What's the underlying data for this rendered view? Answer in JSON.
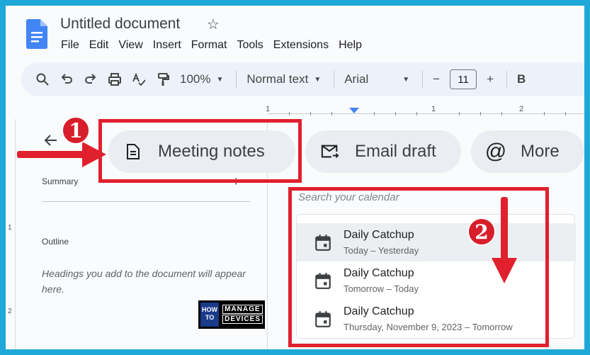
{
  "document": {
    "title": "Untitled document"
  },
  "menu": [
    "File",
    "Edit",
    "View",
    "Insert",
    "Format",
    "Tools",
    "Extensions",
    "Help"
  ],
  "toolbar": {
    "zoom": "100%",
    "style": "Normal text",
    "font": "Arial",
    "font_size": "11",
    "minus": "−",
    "plus": "+",
    "bold": "B"
  },
  "ruler": {
    "labels": [
      "1",
      "1",
      "2"
    ]
  },
  "vruler": {
    "labels": [
      "1",
      "2"
    ]
  },
  "outline": {
    "summary_label": "Summary",
    "add_symbol": "+",
    "outline_label": "Outline",
    "hint": "Headings you add to the document will appear here."
  },
  "chips": {
    "meeting_notes": "Meeting notes",
    "email_draft": "Email draft",
    "more": "More"
  },
  "calendar": {
    "search_placeholder": "Search your calendar",
    "events": [
      {
        "name": "Daily Catchup",
        "when": "Today – Yesterday"
      },
      {
        "name": "Daily Catchup",
        "when": "Tomorrow – Today"
      },
      {
        "name": "Daily Catchup",
        "when": "Thursday, November 9, 2023 – Tomorrow"
      }
    ]
  },
  "annotations": {
    "step1": "1",
    "step2": "2"
  },
  "watermark": {
    "how_to": "HOW TO",
    "manage": "MANAGE",
    "devices": "DEVICES"
  },
  "colors": {
    "accent_red": "#e0202d",
    "docs_blue": "#4285f4",
    "frame_border": "#1ea8d8"
  }
}
